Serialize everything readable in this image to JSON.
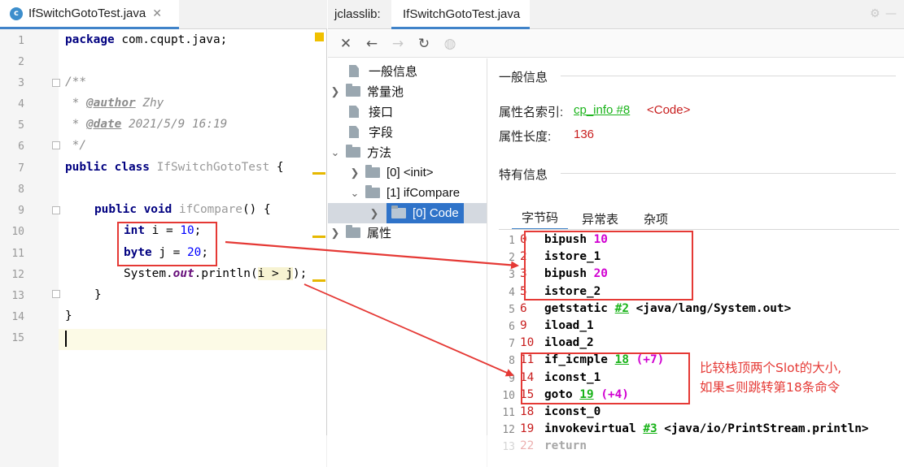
{
  "editor": {
    "tab_label": "IfSwitchGotoTest.java",
    "class_icon_letter": "c",
    "line_numbers": [
      "1",
      "2",
      "3",
      "4",
      "5",
      "6",
      "7",
      "8",
      "9",
      "10",
      "11",
      "12",
      "13",
      "14",
      "15"
    ],
    "code": {
      "l1_kw": "package",
      "l1_rest": " com.cqupt.java;",
      "l3": "/**",
      "l4_star": " * ",
      "l4_tag": "@author",
      "l4_val": " Zhy",
      "l5_star": " * ",
      "l5_tag": "@date",
      "l5_val": " 2021/5/9 16:19",
      "l6": " */",
      "l7_kw": "public class",
      "l7_name": " IfSwitchGotoTest",
      "l7_rest": " {",
      "l9_kw": "public void",
      "l9_name": " ifCompare",
      "l9_rest": "() {",
      "l10_kw": "int",
      "l10_mid": " i = ",
      "l10_num": "10",
      "l10_end": ";",
      "l11_kw": "byte",
      "l11_mid": " j = ",
      "l11_num": "20",
      "l11_end": ";",
      "l12_a": "System.",
      "l12_field": "out",
      "l12_b": ".println(",
      "l12_hl": "i > j",
      "l12_c": ");",
      "l13": "}",
      "l14": "}"
    }
  },
  "jclasslib": {
    "title_label": "jclasslib:",
    "file_tab": "IfSwitchGotoTest.java",
    "toolbar_icons": [
      "close-icon",
      "back-icon",
      "forward-icon",
      "refresh-icon",
      "web-icon"
    ],
    "tree": {
      "general": "一般信息",
      "constant_pool": "常量池",
      "interfaces": "接口",
      "fields": "字段",
      "methods": "方法",
      "method0": "[0] <init>",
      "method1": "[1] ifCompare",
      "code": "[0] Code",
      "attributes": "属性"
    },
    "detail": {
      "general_title": "一般信息",
      "attr_name_index_label": "属性名索引:",
      "attr_name_index_link": "cp_info #8",
      "attr_name_index_value": "<Code>",
      "attr_length_label": "属性长度:",
      "attr_length_value": "136",
      "specific_title": "特有信息",
      "tabs": [
        "字节码",
        "异常表",
        "杂项"
      ]
    },
    "bytecode": [
      {
        "line": "1",
        "offset": "0",
        "op": "bipush",
        "arg": " 10"
      },
      {
        "line": "2",
        "offset": "2",
        "op": "istore_1"
      },
      {
        "line": "3",
        "offset": "3",
        "op": "bipush",
        "arg": " 20"
      },
      {
        "line": "4",
        "offset": "5",
        "op": "istore_2"
      },
      {
        "line": "5",
        "offset": "6",
        "op": "getstatic",
        "ref": "#2",
        "comment": " <java/lang/System.out>"
      },
      {
        "line": "6",
        "offset": "9",
        "op": "iload_1"
      },
      {
        "line": "7",
        "offset": "10",
        "op": "iload_2"
      },
      {
        "line": "8",
        "offset": "11",
        "op": "if_icmple",
        "ref": "18",
        "rel": " (+7)"
      },
      {
        "line": "9",
        "offset": "14",
        "op": "iconst_1"
      },
      {
        "line": "10",
        "offset": "15",
        "op": "goto",
        "ref": "19",
        "rel": " (+4)"
      },
      {
        "line": "11",
        "offset": "18",
        "op": "iconst_0"
      },
      {
        "line": "12",
        "offset": "19",
        "op": "invokevirtual",
        "ref": "#3",
        "comment": " <java/io/PrintStream.println>"
      },
      {
        "line": "13",
        "offset": "22",
        "op": "return"
      }
    ]
  },
  "annotation": {
    "note_line1": "比较栈顶两个Slot的大小,",
    "note_line2": "如果≤则跳转第18条命令",
    "color": "#e53935"
  }
}
